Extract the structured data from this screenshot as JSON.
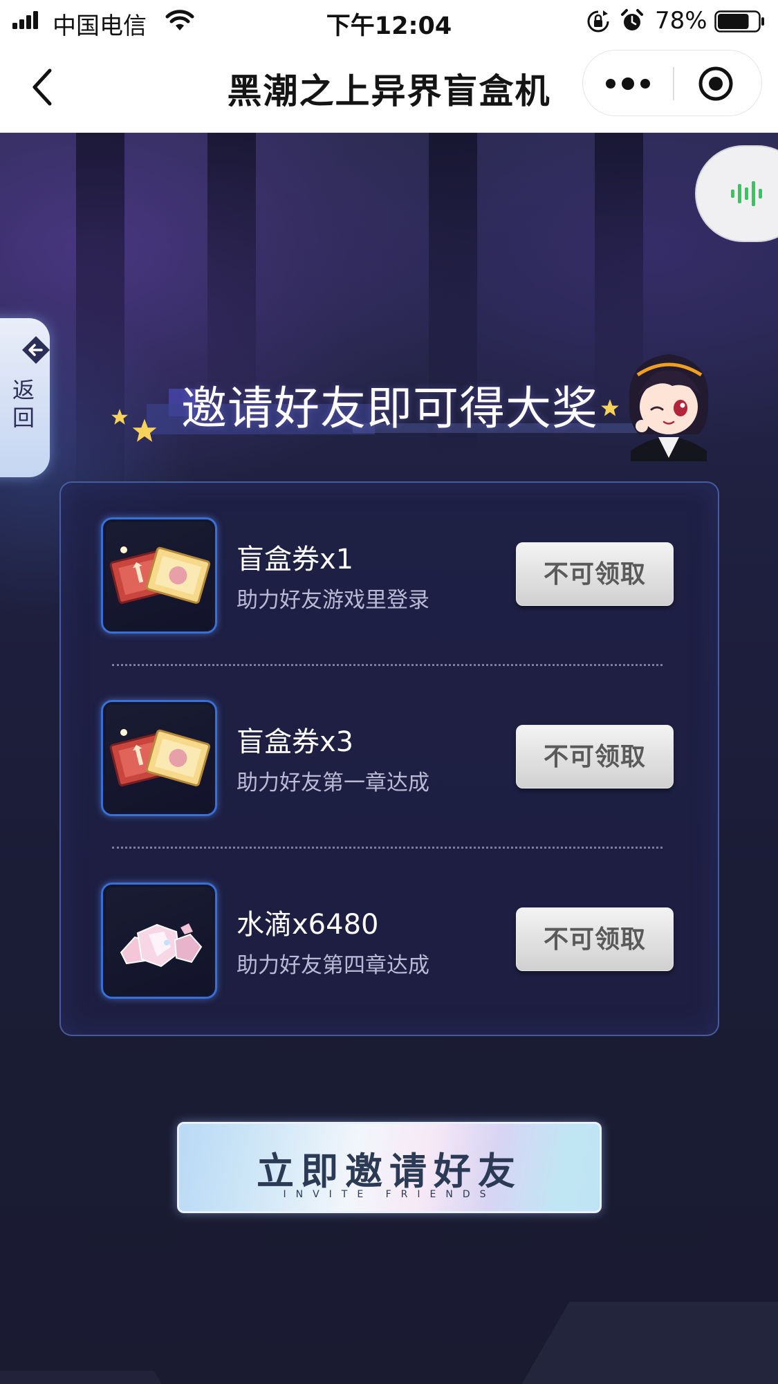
{
  "status_bar": {
    "carrier": "中国电信",
    "time": "下午12:04",
    "battery": "78%",
    "battery_level": 0.78,
    "icons": [
      "signal-icon",
      "wifi-icon",
      "rotation-lock-icon",
      "alarm-icon",
      "battery-icon"
    ]
  },
  "title_bar": {
    "title": "黑潮之上异界盲盒机",
    "icons": [
      "back-arrow-icon",
      "more-dots-icon",
      "close-target-icon"
    ]
  },
  "side": {
    "back_tab_label": "返回",
    "icons": [
      "back-arrow-diamond-icon",
      "voice-wave-icon"
    ]
  },
  "banner": {
    "title": "邀请好友即可得大奖"
  },
  "rewards": [
    {
      "name": "盲盒券x1",
      "desc": "助力好友游戏里登录",
      "button": "不可领取",
      "icon": "blind-box-ticket-icon"
    },
    {
      "name": "盲盒券x3",
      "desc": "助力好友第一章达成",
      "button": "不可领取",
      "icon": "blind-box-ticket-icon"
    },
    {
      "name": "水滴x6480",
      "desc": "助力好友第四章达成",
      "button": "不可领取",
      "icon": "water-drop-crystal-icon"
    }
  ],
  "invite": {
    "label": "立即邀请好友",
    "sub": "INVITE FRIENDS"
  },
  "colors": {
    "background": "#1c1d33",
    "panel_border": "#5670be",
    "icon_frame": "#3a6fd8",
    "voice_green": "#34c759"
  }
}
